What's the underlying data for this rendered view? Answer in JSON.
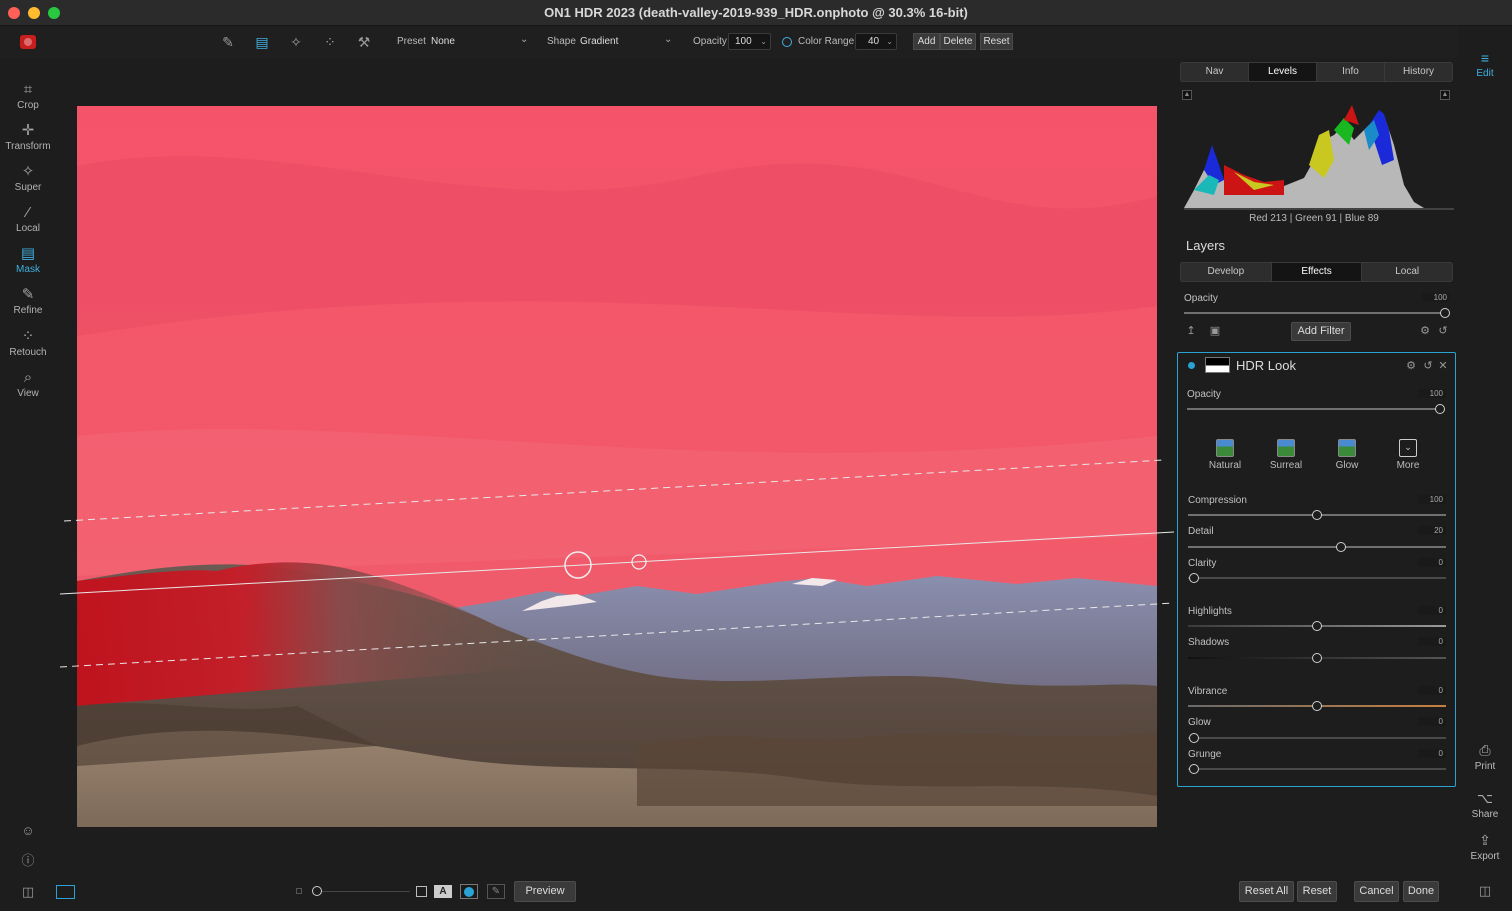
{
  "window": {
    "title": "ON1 HDR 2023 (death-valley-2019-939_HDR.onphoto @ 30.3% 16-bit)"
  },
  "toolbar": {
    "preset_label": "Preset",
    "preset_value": "None",
    "shape_label": "Shape",
    "shape_value": "Gradient",
    "opacity_label": "Opacity",
    "opacity_value": "100",
    "color_range_label": "Color Range",
    "color_range_value": "40",
    "add_label": "Add",
    "delete_label": "Delete",
    "reset_label": "Reset"
  },
  "left_tools": [
    {
      "label": "Crop",
      "icon": "crop-icon"
    },
    {
      "label": "Transform",
      "icon": "transform-icon"
    },
    {
      "label": "Super",
      "icon": "super-brush-icon"
    },
    {
      "label": "Local",
      "icon": "local-brush-icon"
    },
    {
      "label": "Mask",
      "icon": "mask-icon"
    },
    {
      "label": "Refine",
      "icon": "refine-icon"
    },
    {
      "label": "Retouch",
      "icon": "retouch-icon"
    },
    {
      "label": "View",
      "icon": "view-icon"
    }
  ],
  "panel_tabs": [
    "Nav",
    "Levels",
    "Info",
    "History"
  ],
  "histogram": {
    "readout": "Red 213 | Green  91   | Blue  89"
  },
  "layers": {
    "title": "Layers",
    "tabs": [
      "Develop",
      "Effects",
      "Local"
    ],
    "opacity_label": "Opacity",
    "opacity_value": "100",
    "add_filter_label": "Add Filter"
  },
  "filter": {
    "name": "HDR Look",
    "opacity_label": "Opacity",
    "opacity_value": "100",
    "presets": [
      "Natural",
      "Surreal",
      "Glow",
      "More"
    ],
    "sliders": [
      {
        "label": "Compression",
        "value": "100"
      },
      {
        "label": "Detail",
        "value": "20"
      },
      {
        "label": "Clarity",
        "value": "0"
      },
      {
        "label": "Highlights",
        "value": "0"
      },
      {
        "label": "Shadows",
        "value": "0"
      },
      {
        "label": "Vibrance",
        "value": "0"
      },
      {
        "label": "Glow",
        "value": "0"
      },
      {
        "label": "Grunge",
        "value": "0"
      }
    ]
  },
  "right_rail": {
    "edit": "Edit",
    "print": "Print",
    "share": "Share",
    "export": "Export"
  },
  "bottom": {
    "preview_label": "Preview",
    "reset_all_label": "Reset All",
    "reset_label": "Reset",
    "cancel_label": "Cancel",
    "done_label": "Done"
  },
  "colors": {
    "accent": "#2aa3d4",
    "mask_overlay": "#ff3c50"
  }
}
